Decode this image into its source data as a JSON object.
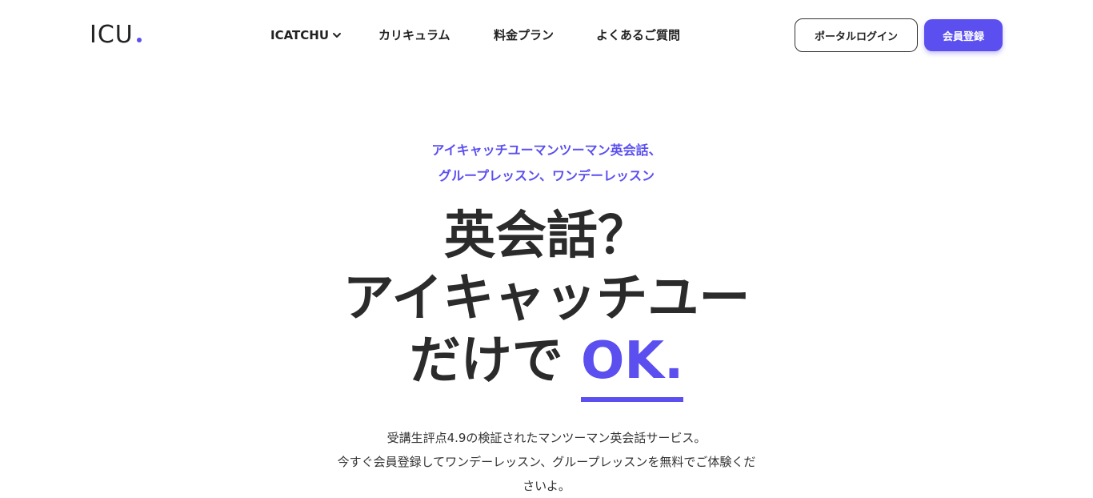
{
  "brand": {
    "logo_text": "ICU",
    "accent_color": "#5b4ff0"
  },
  "nav": {
    "items": [
      {
        "label": "ICATCHU",
        "has_dropdown": true,
        "icon": "chevron-down-icon"
      },
      {
        "label": "カリキュラム"
      },
      {
        "label": "料金プラン"
      },
      {
        "label": "よくあるご質問"
      }
    ]
  },
  "header_buttons": {
    "portal_login": "ポータルログイン",
    "register": "会員登録"
  },
  "hero": {
    "tagline_line1": "アイキャッチユーマンツーマン英会話、",
    "tagline_line2": "グループレッスン、ワンデーレッスン",
    "headline_line1": "英会話？",
    "headline_line2": "アイキャッチユー",
    "headline_line3_prefix": "だけで ",
    "headline_ok": "OK.",
    "description_line1": "受講生評点4.9の検証されたマンツーマン英会話サービス。",
    "description_line2": "今すぐ会員登録してワンデーレッスン、グループレッスンを無料でご体験くだ",
    "description_line3": "さいよ。"
  }
}
